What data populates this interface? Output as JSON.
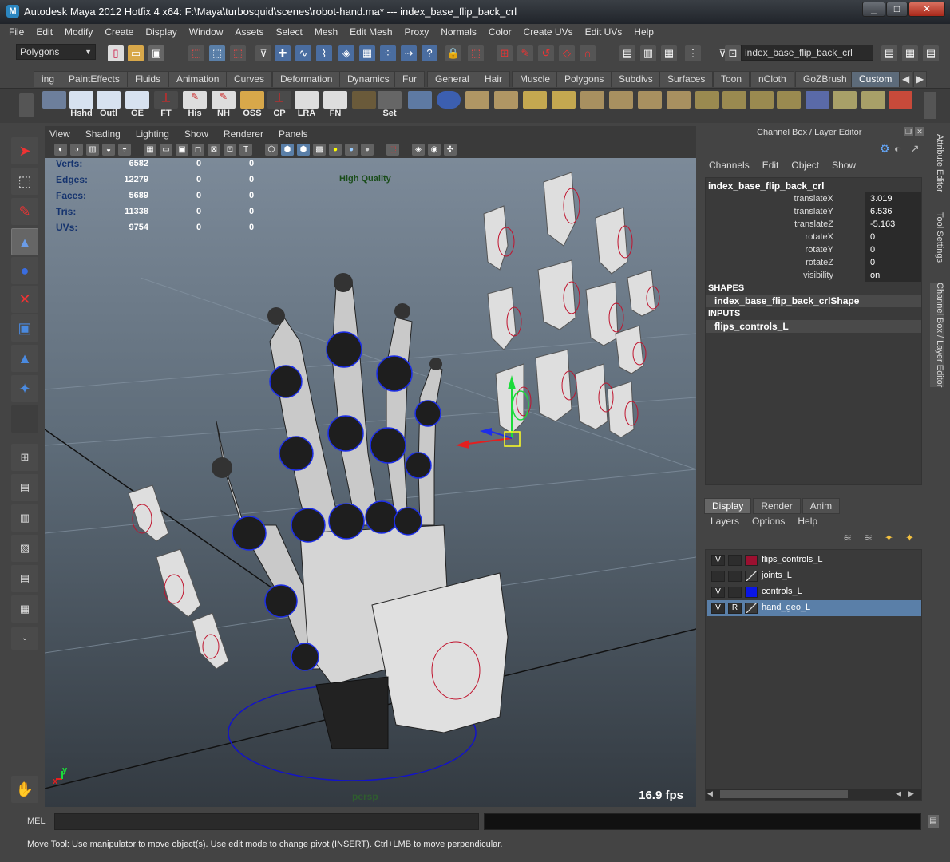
{
  "window": {
    "title": "Autodesk Maya 2012 Hotfix 4 x64: F:\\Maya\\turbosquid\\scenes\\robot-hand.ma*   ---   index_base_flip_back_crl",
    "minimize": "_",
    "maximize": "□",
    "close": "✕"
  },
  "menus": [
    "File",
    "Edit",
    "Modify",
    "Create",
    "Display",
    "Window",
    "Assets",
    "Select",
    "Mesh",
    "Edit Mesh",
    "Proxy",
    "Normals",
    "Color",
    "Create UVs",
    "Edit UVs",
    "Help"
  ],
  "statusline": {
    "menu_set": "Polygons",
    "name_field": "index_base_flip_back_crl"
  },
  "shelf": {
    "tabs": [
      "ing",
      "PaintEffects",
      "Fluids",
      "Animation",
      "Curves",
      "Deformation",
      "Dynamics",
      "Fur",
      "General",
      "Hair",
      "Muscle",
      "Polygons",
      "Subdivs",
      "Surfaces",
      "Toon",
      "nCloth",
      "GoZBrush",
      "Custom"
    ],
    "active_tab": "Custom",
    "labeled_icons": [
      "Hshd",
      "Outl",
      "GE",
      "FT",
      "His",
      "NH",
      "OSS",
      "CP",
      "LRA",
      "FN",
      "Set"
    ]
  },
  "viewport": {
    "menus": [
      "View",
      "Shading",
      "Lighting",
      "Show",
      "Renderer",
      "Panels"
    ],
    "hud": {
      "rows": [
        {
          "label": "Verts:",
          "value": "6582",
          "a": "0",
          "b": "0"
        },
        {
          "label": "Edges:",
          "value": "12279",
          "a": "0",
          "b": "0"
        },
        {
          "label": "Faces:",
          "value": "5689",
          "a": "0",
          "b": "0"
        },
        {
          "label": "Tris:",
          "value": "11338",
          "a": "0",
          "b": "0"
        },
        {
          "label": "UVs:",
          "value": "9754",
          "a": "0",
          "b": "0"
        }
      ],
      "quality": "High Quality",
      "fps": "16.9 fps",
      "camera": "persp",
      "axis_x": "x",
      "axis_y": "y"
    }
  },
  "channel_box": {
    "title": "Channel Box / Layer Editor",
    "menus": [
      "Channels",
      "Edit",
      "Object",
      "Show"
    ],
    "object": "index_base_flip_back_crl",
    "channels": [
      {
        "name": "translateX",
        "value": "3.019"
      },
      {
        "name": "translateY",
        "value": "6.536"
      },
      {
        "name": "translateZ",
        "value": "-5.163"
      },
      {
        "name": "rotateX",
        "value": "0"
      },
      {
        "name": "rotateY",
        "value": "0"
      },
      {
        "name": "rotateZ",
        "value": "0"
      },
      {
        "name": "visibility",
        "value": "on"
      }
    ],
    "shapes_header": "SHAPES",
    "shape": "index_base_flip_back_crlShape",
    "inputs_header": "INPUTS",
    "input": "flips_controls_L"
  },
  "side_tabs": [
    "Attribute Editor",
    "Tool Settings",
    "Channel Box / Layer Editor"
  ],
  "layer_editor": {
    "tabs": [
      "Display",
      "Render",
      "Anim"
    ],
    "active_tab": "Display",
    "menus": [
      "Layers",
      "Options",
      "Help"
    ],
    "layers": [
      {
        "v": "V",
        "r": "",
        "color": "#9b1030",
        "name": "flips_controls_L",
        "selected": false
      },
      {
        "v": "",
        "r": "",
        "color": "none",
        "name": "joints_L",
        "selected": false
      },
      {
        "v": "V",
        "r": "",
        "color": "#0a16e6",
        "name": "controls_L",
        "selected": false
      },
      {
        "v": "V",
        "r": "R",
        "color": "none",
        "name": "hand_geo_L",
        "selected": true
      }
    ]
  },
  "command_line": {
    "label": "MEL"
  },
  "help_line": "Move Tool: Use manipulator to move object(s). Use edit mode to change pivot (INSERT).  Ctrl+LMB to move perpendicular."
}
